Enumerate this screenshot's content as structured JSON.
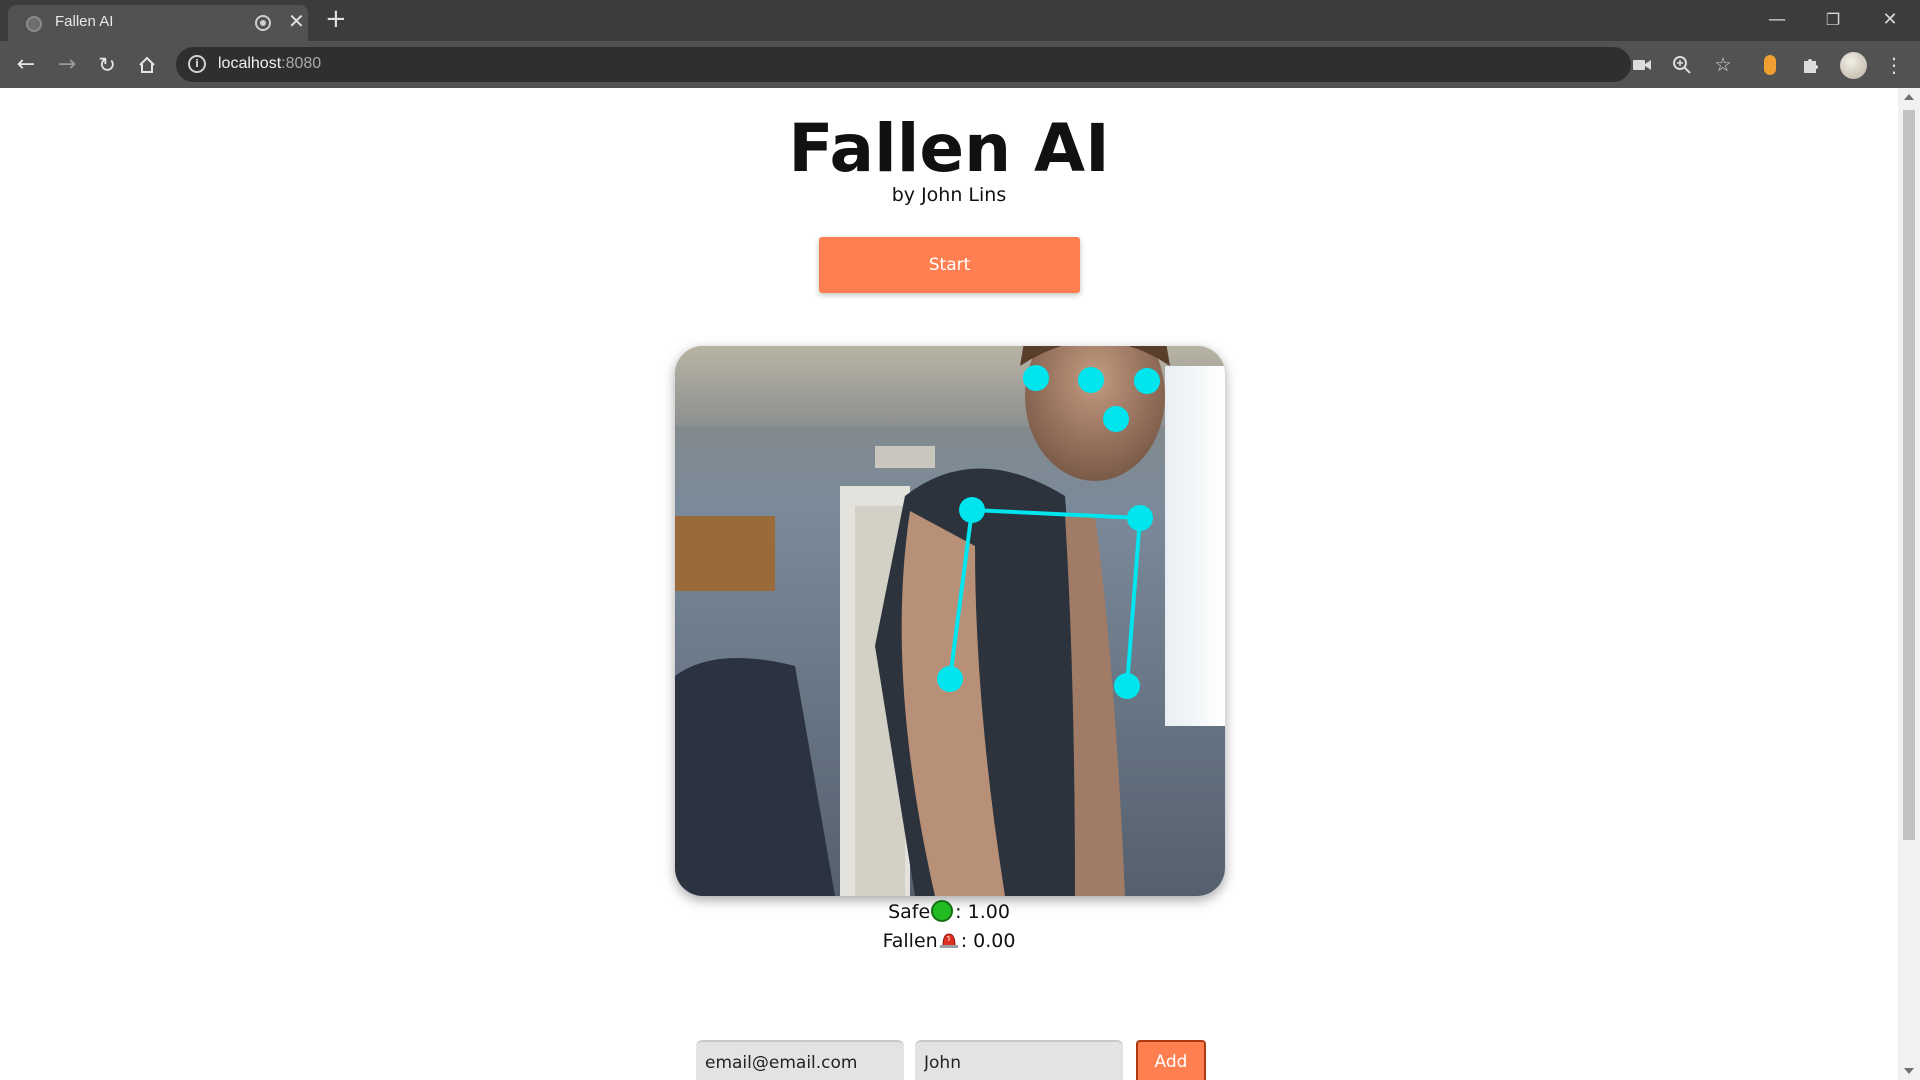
{
  "browser": {
    "tab_title": "Fallen AI",
    "tab_close": "✕",
    "new_tab": "+",
    "url_host": "localhost",
    "url_port": ":8080",
    "window_controls": {
      "minimize": "—",
      "restore": "❐",
      "close": "✕"
    },
    "icons": {
      "back": "back-arrow-icon",
      "forward": "forward-arrow-icon",
      "reload": "reload-icon",
      "home": "home-icon",
      "camera": "camera-icon",
      "zoom": "zoom-icon",
      "bookmark": "star-icon",
      "extensions": "puzzle-icon",
      "menu": "kebab-menu-icon"
    }
  },
  "page": {
    "title": "Fallen AI",
    "subtitle": "by John Lins",
    "start_label": "Start",
    "safe_label": "Safe",
    "safe_value": ": 1.00",
    "fallen_label": "Fallen",
    "fallen_value": ": 0.00",
    "email_value": "email@email.com",
    "name_value": "John",
    "add_label": "Add"
  },
  "colors": {
    "accent": "#ff7f50",
    "keypoint": "#00e5ee",
    "safe": "#22bb22",
    "alarm": "#e03020"
  }
}
